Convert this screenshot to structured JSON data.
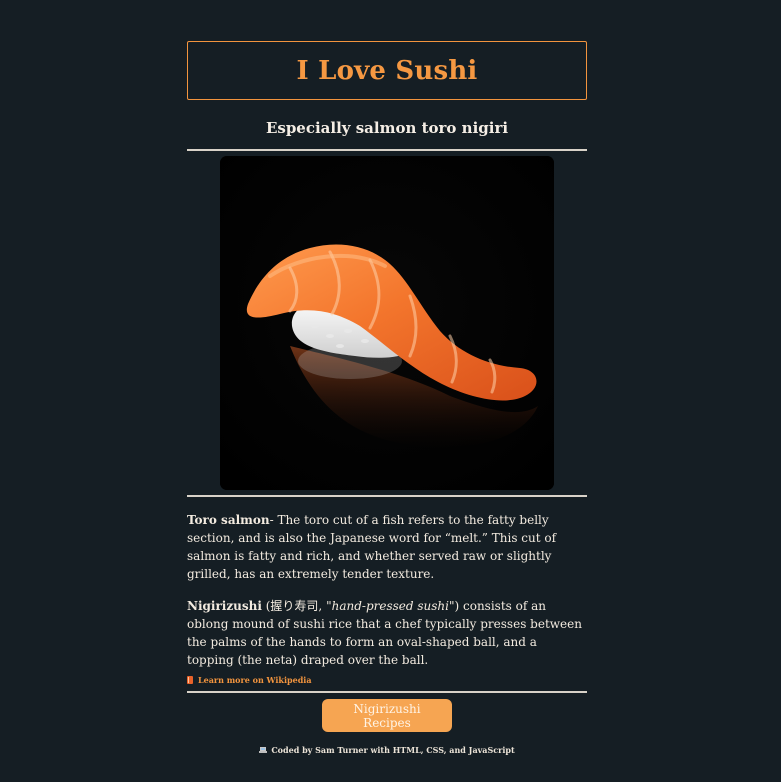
{
  "header": {
    "title": "I Love Sushi",
    "subtitle": "Especially salmon toro nigiri"
  },
  "image": {
    "name": "salmon-toro-nigiri-photo"
  },
  "paragraphs": {
    "toro": {
      "term": "Toro salmon",
      "text": "- The toro cut of a fish refers to the fatty belly section, and is also the Japanese word for “melt.” This cut of salmon is fatty and rich, and whether served raw or slightly grilled, has an extremely tender texture."
    },
    "nigiri": {
      "term": "Nigirizushi",
      "open": " (握り寿司, ",
      "italic": "\"hand-pressed sushi\"",
      "text": ") consists of an oblong mound of sushi rice that a chef typically presses between the palms of the hands to form an oval-shaped ball, and a topping (the neta) draped over the ball."
    }
  },
  "links": {
    "wiki_label": "Learn more on Wikipedia",
    "wiki_icon": "book-icon"
  },
  "actions": {
    "recipes_label": "Nigirizushi Recipes"
  },
  "footer": {
    "text": "Coded by Sam Turner with HTML, CSS, and JavaScript",
    "icon": "laptop-icon"
  },
  "colors": {
    "background": "#151e24",
    "accent": "#f59842",
    "button": "#f6a552",
    "text": "#f3ebe0"
  }
}
